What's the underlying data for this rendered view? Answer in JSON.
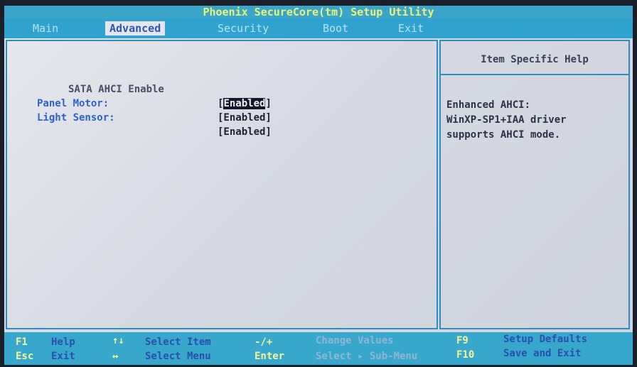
{
  "title": "Phoenix SecureCore(tm) Setup Utility",
  "menu": {
    "tabs": [
      {
        "label": "Main"
      },
      {
        "label": "Advanced"
      },
      {
        "label": "Security"
      },
      {
        "label": "Boot"
      },
      {
        "label": "Exit"
      }
    ],
    "active": "Advanced"
  },
  "settings": [
    {
      "label": "SATA AHCI Enable",
      "value": "Enabled",
      "selected": true
    },
    {
      "label": "Panel Motor:",
      "value": "[Enabled]",
      "selected": false
    },
    {
      "label": "Light Sensor:",
      "value": "[Enabled]",
      "selected": false
    }
  ],
  "help": {
    "title": "Item Specific Help",
    "lines": [
      "Enhanced AHCI:",
      "WinXP-SP1+IAA driver",
      "supports AHCI mode."
    ]
  },
  "footer": {
    "row1": [
      {
        "key": "F1",
        "desc": "Help"
      },
      {
        "key": "↑↓",
        "desc": "Select Item"
      },
      {
        "key": "-/+",
        "desc": "Change Values"
      },
      {
        "key": "F9",
        "desc": "Setup Defaults"
      }
    ],
    "row2": [
      {
        "key": "Esc",
        "desc": "Exit"
      },
      {
        "key": "↔",
        "desc": "Select Menu"
      },
      {
        "key": "Enter",
        "desc": "Select ▸ Sub-Menu"
      },
      {
        "key": "F10",
        "desc": "Save and Exit"
      }
    ]
  },
  "colors": {
    "title_bg": "#3aa4c9",
    "title_text": "#e9f27a",
    "active_tab_text": "#2a58b7",
    "setting_label": "#2f63c8",
    "screen_bg": "#e2e4ea"
  }
}
